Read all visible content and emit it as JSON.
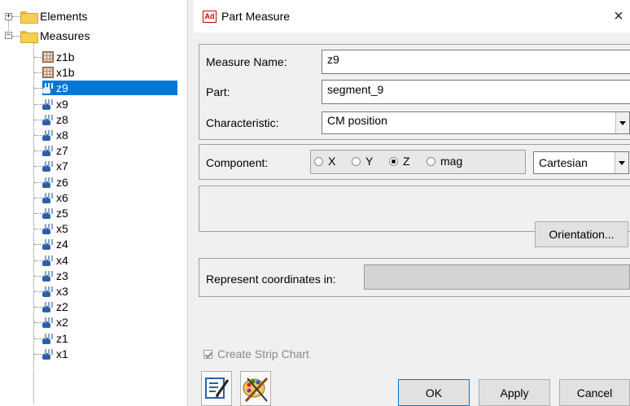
{
  "tree": {
    "elements_label": "Elements",
    "measures_label": "Measures",
    "items": [
      {
        "label": "z1b",
        "icon": "calculator-icon"
      },
      {
        "label": "x1b",
        "icon": "calculator-icon"
      },
      {
        "label": "z9",
        "icon": "measure-icon",
        "selected": true
      },
      {
        "label": "x9",
        "icon": "measure-icon"
      },
      {
        "label": "z8",
        "icon": "measure-icon"
      },
      {
        "label": "x8",
        "icon": "measure-icon"
      },
      {
        "label": "z7",
        "icon": "measure-icon"
      },
      {
        "label": "x7",
        "icon": "measure-icon"
      },
      {
        "label": "z6",
        "icon": "measure-icon"
      },
      {
        "label": "x6",
        "icon": "measure-icon"
      },
      {
        "label": "z5",
        "icon": "measure-icon"
      },
      {
        "label": "x5",
        "icon": "measure-icon"
      },
      {
        "label": "z4",
        "icon": "measure-icon"
      },
      {
        "label": "x4",
        "icon": "measure-icon"
      },
      {
        "label": "z3",
        "icon": "measure-icon"
      },
      {
        "label": "x3",
        "icon": "measure-icon"
      },
      {
        "label": "z2",
        "icon": "measure-icon"
      },
      {
        "label": "x2",
        "icon": "measure-icon"
      },
      {
        "label": "z1",
        "icon": "measure-icon"
      },
      {
        "label": "x1",
        "icon": "measure-icon"
      }
    ]
  },
  "dialog": {
    "app_icon": "Ad",
    "title": "Part Measure",
    "close": "×",
    "measure_name_label": "Measure Name:",
    "measure_name_value": "z9",
    "part_label": "Part:",
    "part_value": "segment_9",
    "characteristic_label": "Characteristic:",
    "characteristic_value": "CM position",
    "component_label": "Component:",
    "component_options": [
      "X",
      "Y",
      "Z",
      "mag"
    ],
    "component_selected": "Z",
    "coord_system_value": "Cartesian",
    "orientation_button": "Orientation...",
    "represent_label": "Represent coordinates in:",
    "represent_value": "",
    "strip_chart_label": "Create Strip Chart",
    "strip_chart_checked": true,
    "ok_button": "OK",
    "apply_button": "Apply",
    "cancel_button": "Cancel"
  },
  "colors": {
    "selection": "#0078d7",
    "dialog_bg": "#f0f0f0",
    "folder": "#f6cf52"
  }
}
